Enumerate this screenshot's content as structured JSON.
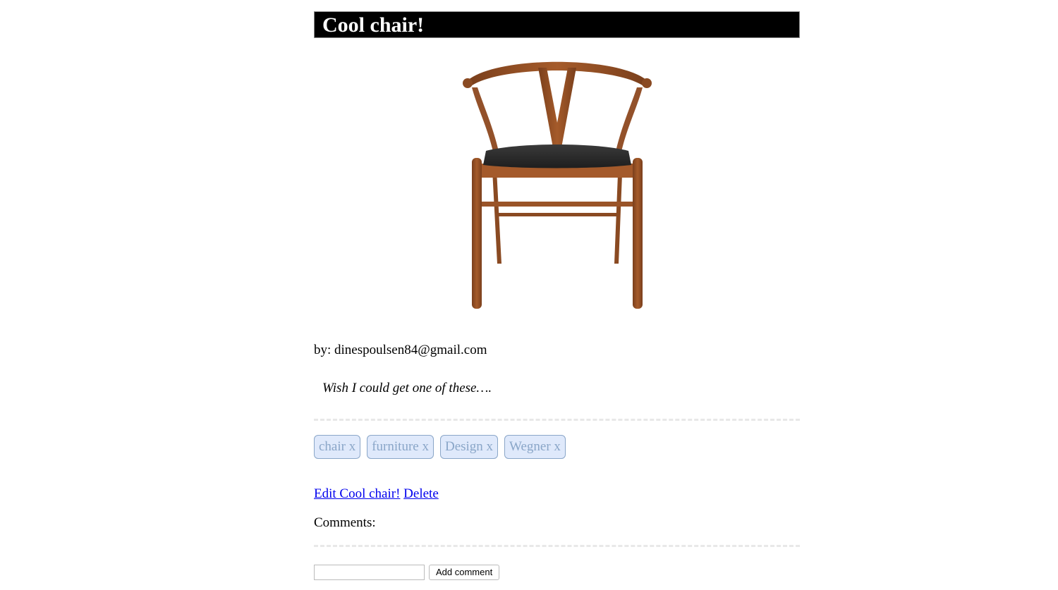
{
  "post": {
    "title": "Cool chair!",
    "image_alt": "Wooden wishbone chair with dark seat",
    "author": "by: dinespoulsen84@gmail.com",
    "description": "Wish I could get one of these…."
  },
  "tags": [
    {
      "label": "chair x"
    },
    {
      "label": "furniture x"
    },
    {
      "label": "Design x"
    },
    {
      "label": "Wegner x"
    }
  ],
  "actions": {
    "edit_label": "Edit Cool chair!",
    "delete_label": "Delete"
  },
  "comments": {
    "label": "Comments:",
    "input_value": "",
    "input_placeholder": "",
    "button_label": "Add comment"
  },
  "colors": {
    "title_bg": "#000000",
    "title_text": "#ffffff",
    "tag_bg": "#dfe9fb",
    "tag_border": "#8aa6c8",
    "link": "#0000ee"
  }
}
